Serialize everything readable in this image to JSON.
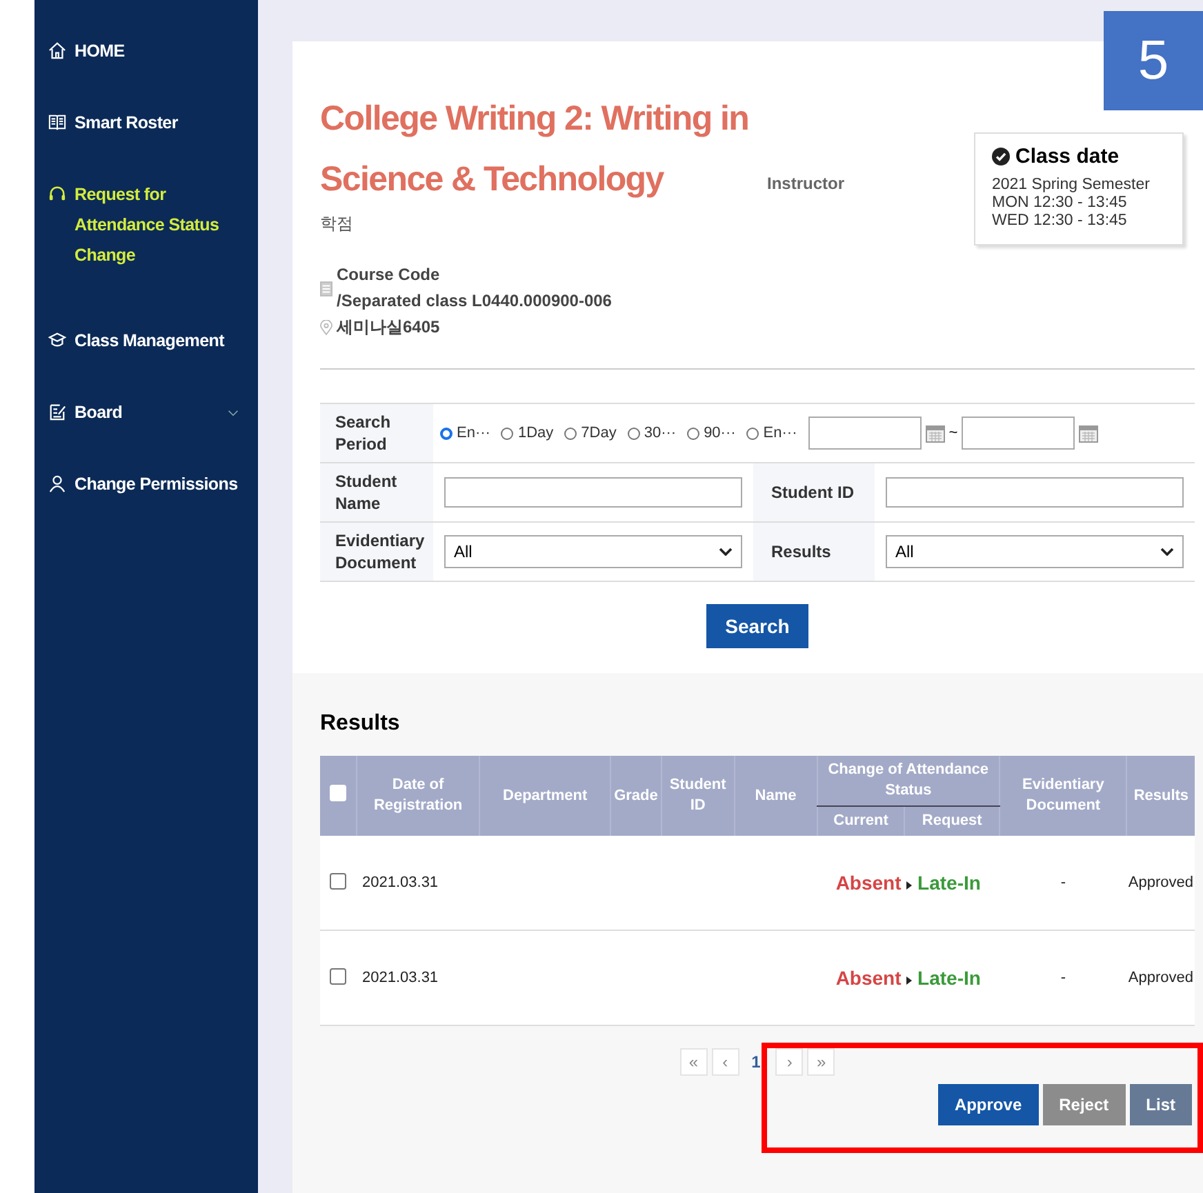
{
  "sidebar": {
    "items": [
      {
        "label": "HOME",
        "selected": false,
        "dropdown": false
      },
      {
        "label": "Smart Roster",
        "selected": false,
        "dropdown": false
      },
      {
        "label": "Request for Attendance Status Change",
        "selected": true,
        "dropdown": false
      },
      {
        "label": "Class Management",
        "selected": false,
        "dropdown": false
      },
      {
        "label": "Board",
        "selected": false,
        "dropdown": true
      },
      {
        "label": "Change Permissions",
        "selected": false,
        "dropdown": false
      }
    ]
  },
  "badge": "5",
  "course": {
    "title": "College Writing 2: Writing in Science & Technology",
    "credit_label": "학점",
    "instructor_label": "Instructor",
    "course_code_label": "Course Code",
    "course_code": "/Separated class L0440.000900-006",
    "room": "세미나실6405"
  },
  "class_date": {
    "title": "Class date",
    "lines": [
      "2021 Spring Semester",
      "MON 12:30 - 13:45",
      "WED 12:30 - 13:45"
    ]
  },
  "search": {
    "period_label": "Search Period",
    "periods": [
      {
        "label": "En···",
        "selected": true
      },
      {
        "label": "1Day",
        "selected": false
      },
      {
        "label": "7Day",
        "selected": false
      },
      {
        "label": "30···",
        "selected": false
      },
      {
        "label": "90···",
        "selected": false
      },
      {
        "label": "En···",
        "selected": false
      }
    ],
    "date_separator": "~",
    "student_name_label": "Student Name",
    "student_id_label": "Student ID",
    "evidence_label": "Evidentiary Document",
    "evidence_value": "All",
    "results_label": "Results",
    "results_value": "All",
    "button": "Search"
  },
  "results": {
    "title": "Results",
    "select_all_checked": false,
    "columns": {
      "date": "Date of Registration",
      "department": "Department",
      "grade": "Grade",
      "student_id": "Student ID",
      "name": "Name",
      "change": "Change of Attendance Status",
      "current": "Current",
      "request": "Request",
      "evidence": "Evidentiary Document",
      "result": "Results"
    },
    "rows": [
      {
        "checked": false,
        "date": "2021.03.31",
        "current": "Absent",
        "request": "Late-In",
        "evidence": "-",
        "result": "Approved"
      },
      {
        "checked": false,
        "date": "2021.03.31",
        "current": "Absent",
        "request": "Late-In",
        "evidence": "-",
        "result": "Approved"
      }
    ]
  },
  "pagination": {
    "first": "«",
    "prev": "‹",
    "pages": [
      {
        "label": "1",
        "selected": true
      }
    ],
    "next": "›",
    "last": "»"
  },
  "actions": [
    {
      "label": "Approve",
      "kind": "primary"
    },
    {
      "label": "Reject",
      "kind": "danger"
    },
    {
      "label": "List",
      "kind": "neutral"
    }
  ]
}
